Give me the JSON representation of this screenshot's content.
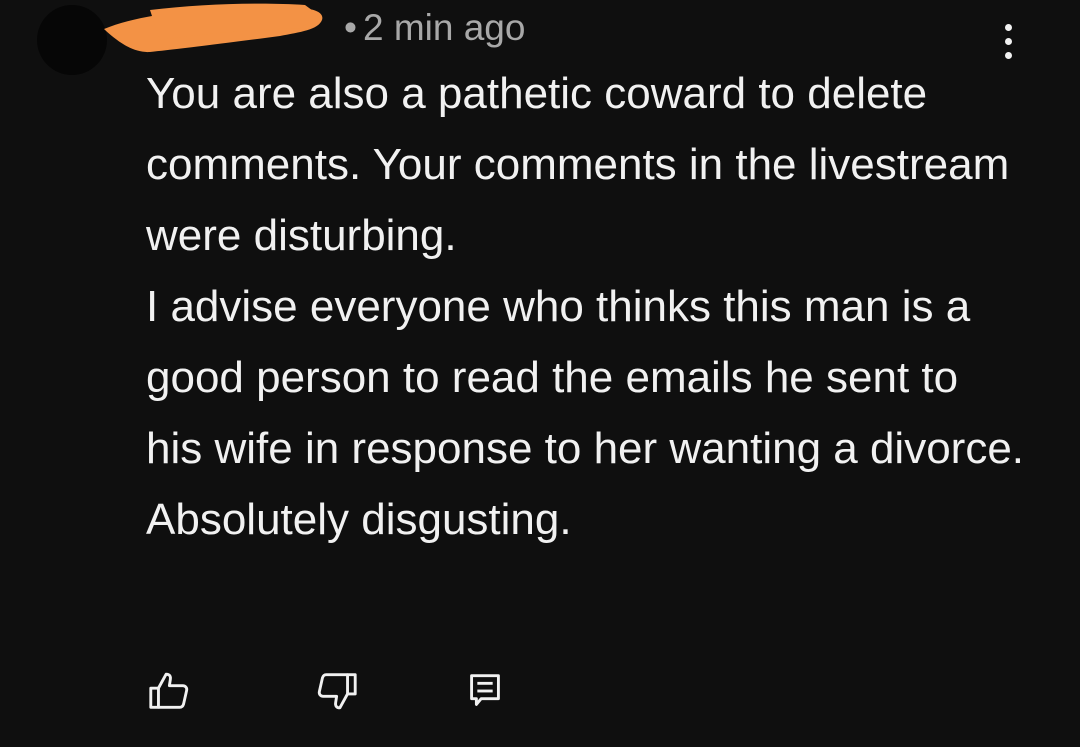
{
  "comment": {
    "author": "",
    "separator": "•",
    "timestamp": "2 min ago",
    "body_paragraphs": [
      "You are also a pathetic coward to delete comments. Your comments in the livestream were disturbing.",
      "I advise everyone who thinks this man is a good person to read the emails he sent to his wife in response to her wanting a divorce. Absolutely disgusting."
    ]
  },
  "actions": {
    "like_icon": "thumbs-up-icon",
    "dislike_icon": "thumbs-down-icon",
    "reply_icon": "reply-icon"
  },
  "colors": {
    "background": "#0f0f0f",
    "text": "#f1f1f1",
    "meta_text": "#a8a8a8",
    "redaction": "#f39245"
  }
}
